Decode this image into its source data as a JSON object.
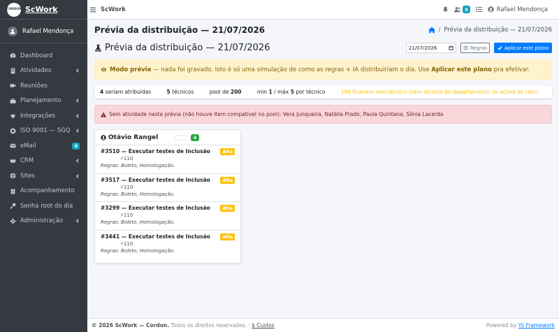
{
  "brand": {
    "logo": "CORDON",
    "name": "ScWork"
  },
  "sidebar": {
    "user": "Rafael Mendonça",
    "items": [
      {
        "label": "Dashboard",
        "icon": "dashboard-icon",
        "chevron": false
      },
      {
        "label": "Atividades",
        "icon": "tasks-icon",
        "chevron": true
      },
      {
        "label": "Reuniões",
        "icon": "video-icon",
        "chevron": false
      },
      {
        "label": "Planejamento",
        "icon": "briefcase-icon",
        "chevron": true
      },
      {
        "label": "Integrações",
        "icon": "plug-icon",
        "chevron": true
      },
      {
        "label": "ISO 9001 — SGQ",
        "icon": "certificate-icon",
        "chevron": true
      },
      {
        "label": "eMail",
        "icon": "envelope-icon",
        "badge": "9"
      },
      {
        "label": "CRM",
        "icon": "handshake-icon",
        "chevron": true
      },
      {
        "label": "Sites",
        "icon": "globe-icon",
        "chevron": true
      },
      {
        "label": "Acompanhamento",
        "icon": "clipboard-icon",
        "chevron": false
      },
      {
        "label": "Senha root do dia",
        "icon": "key-icon",
        "chevron": false
      },
      {
        "label": "Administração",
        "icon": "cog-icon",
        "chevron": true
      }
    ]
  },
  "topbar": {
    "title": "ScWork",
    "badge": "9",
    "user": "Rafael Mendonça"
  },
  "page": {
    "title": "Prévia da distribuição — 21/07/2026",
    "breadcrumb_current": "Prévia da distribuição — 21/07/2026",
    "subtitle": "Prévia da distribuição — 21/07/2026",
    "date_value": "21/07/2026",
    "regras_label": "Regras",
    "apply_label": "Aplicar este plano"
  },
  "alert_warning": {
    "strong": "Modo prévia",
    "text1": " — nada foi gravado. Isto é só uma simulação de como as regras + IA distribuiriam o dia. Use ",
    "strong2": "Aplicar este plano",
    "text2": " pra efetivar."
  },
  "stats": {
    "assigned_count": "4",
    "assigned_label": "seriam atribuídas",
    "tech_count": "5",
    "tech_label": "técnicos",
    "pool_label": "pool de",
    "pool_value": "200",
    "min_label": "min",
    "min_value": "1",
    "max_label": "máx",
    "max_value": "5",
    "per_tech_label": "por técnico",
    "unassigned": "196 ficariam sem técnico (sem técnico do departamento ou acima do teto)"
  },
  "alert_danger": {
    "text": "Sem atividade nesta prévia (não houve item compatível no pool): Vera Junqueira, Natália Prado, Paula Quintana, Sônia Lacerda"
  },
  "card": {
    "tech_name": "Otávio Rangel",
    "count": "4",
    "items": [
      {
        "title": "#3510 — Executar testes de Inclusão",
        "priority": "Alta",
        "points": "⚡110",
        "rules": "Regras: Boleto, Homologação."
      },
      {
        "title": "#3517 — Executar testes de Inclusão",
        "priority": "Alta",
        "points": "⚡110",
        "rules": "Regras: Boleto, Homologação."
      },
      {
        "title": "#3299 — Executar testes de Inclusão",
        "priority": "Alta",
        "points": "⚡110",
        "rules": "Regras: Boleto, Homologação."
      },
      {
        "title": "#3441 — Executar testes de Inclusão",
        "priority": "Alta",
        "points": "⚡110",
        "rules": "Regras: Boleto, Homologação."
      }
    ]
  },
  "footer": {
    "copyright": "© 2026 ScWork — Cordon.",
    "rights": " Todos os direitos reservados.",
    "costs_link": "Custos",
    "powered": "Powered by ",
    "framework": "Yii Framework"
  },
  "colors": {
    "sidebar_bg": "#343a40",
    "primary": "#007bff",
    "warning": "#ffc107",
    "success": "#28a745",
    "info": "#17a2b8"
  }
}
